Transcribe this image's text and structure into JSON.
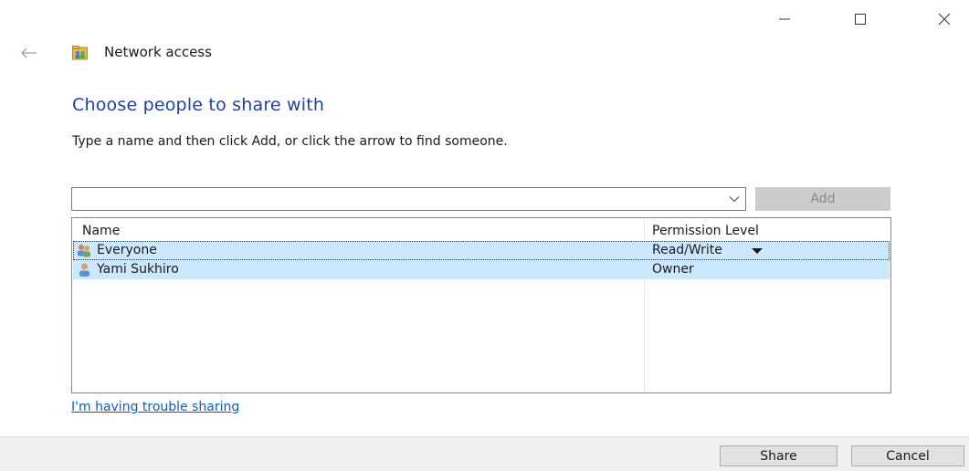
{
  "window": {
    "title": "Network access",
    "controls": {
      "minimize_icon": "minimize-icon",
      "maximize_icon": "maximize-icon",
      "close_icon": "close-icon"
    },
    "back_icon": "back-arrow-icon"
  },
  "main": {
    "heading": "Choose people to share with",
    "instruction": "Type a name and then click Add, or click the arrow to find someone.",
    "name_input": {
      "value": "",
      "placeholder": ""
    },
    "add_label": "Add"
  },
  "share_list": {
    "columns": [
      "Name",
      "Permission Level"
    ],
    "rows": [
      {
        "name": "Everyone",
        "permission": "Read/Write",
        "icon": "group-icon",
        "selected": true,
        "has_dropdown": true
      },
      {
        "name": "Yami Sukhiro",
        "permission": "Owner",
        "icon": "user-icon",
        "selected": true,
        "has_dropdown": false
      }
    ]
  },
  "trouble_link": "I'm having trouble sharing",
  "footer": {
    "share_label": "Share",
    "cancel_label": "Cancel"
  },
  "colors": {
    "heading": "#1f3fa8",
    "link": "#0a5fc2",
    "row_selected": "#cce8ff",
    "add_disabled_bg": "#cccccc",
    "footer_bg": "#f0f0f0"
  }
}
